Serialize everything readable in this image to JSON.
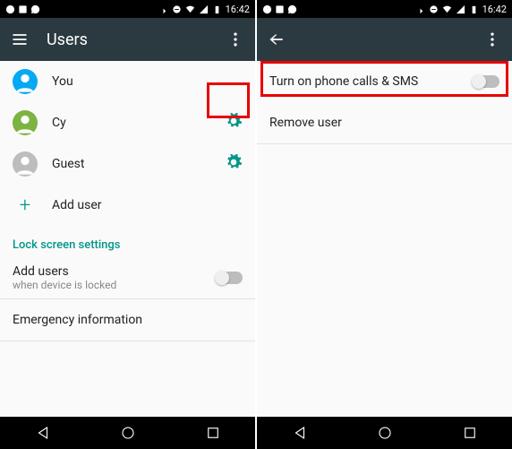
{
  "statusbar": {
    "time": "16:42"
  },
  "left": {
    "title": "Users",
    "users": [
      {
        "label": "You"
      },
      {
        "label": "Cy"
      },
      {
        "label": "Guest"
      }
    ],
    "add_user": "Add user",
    "section": "Lock screen settings",
    "add_users_title": "Add users",
    "add_users_sub": "when device is locked",
    "emergency": "Emergency information"
  },
  "right": {
    "toggle_label": "Turn on phone calls & SMS",
    "remove_label": "Remove user"
  }
}
